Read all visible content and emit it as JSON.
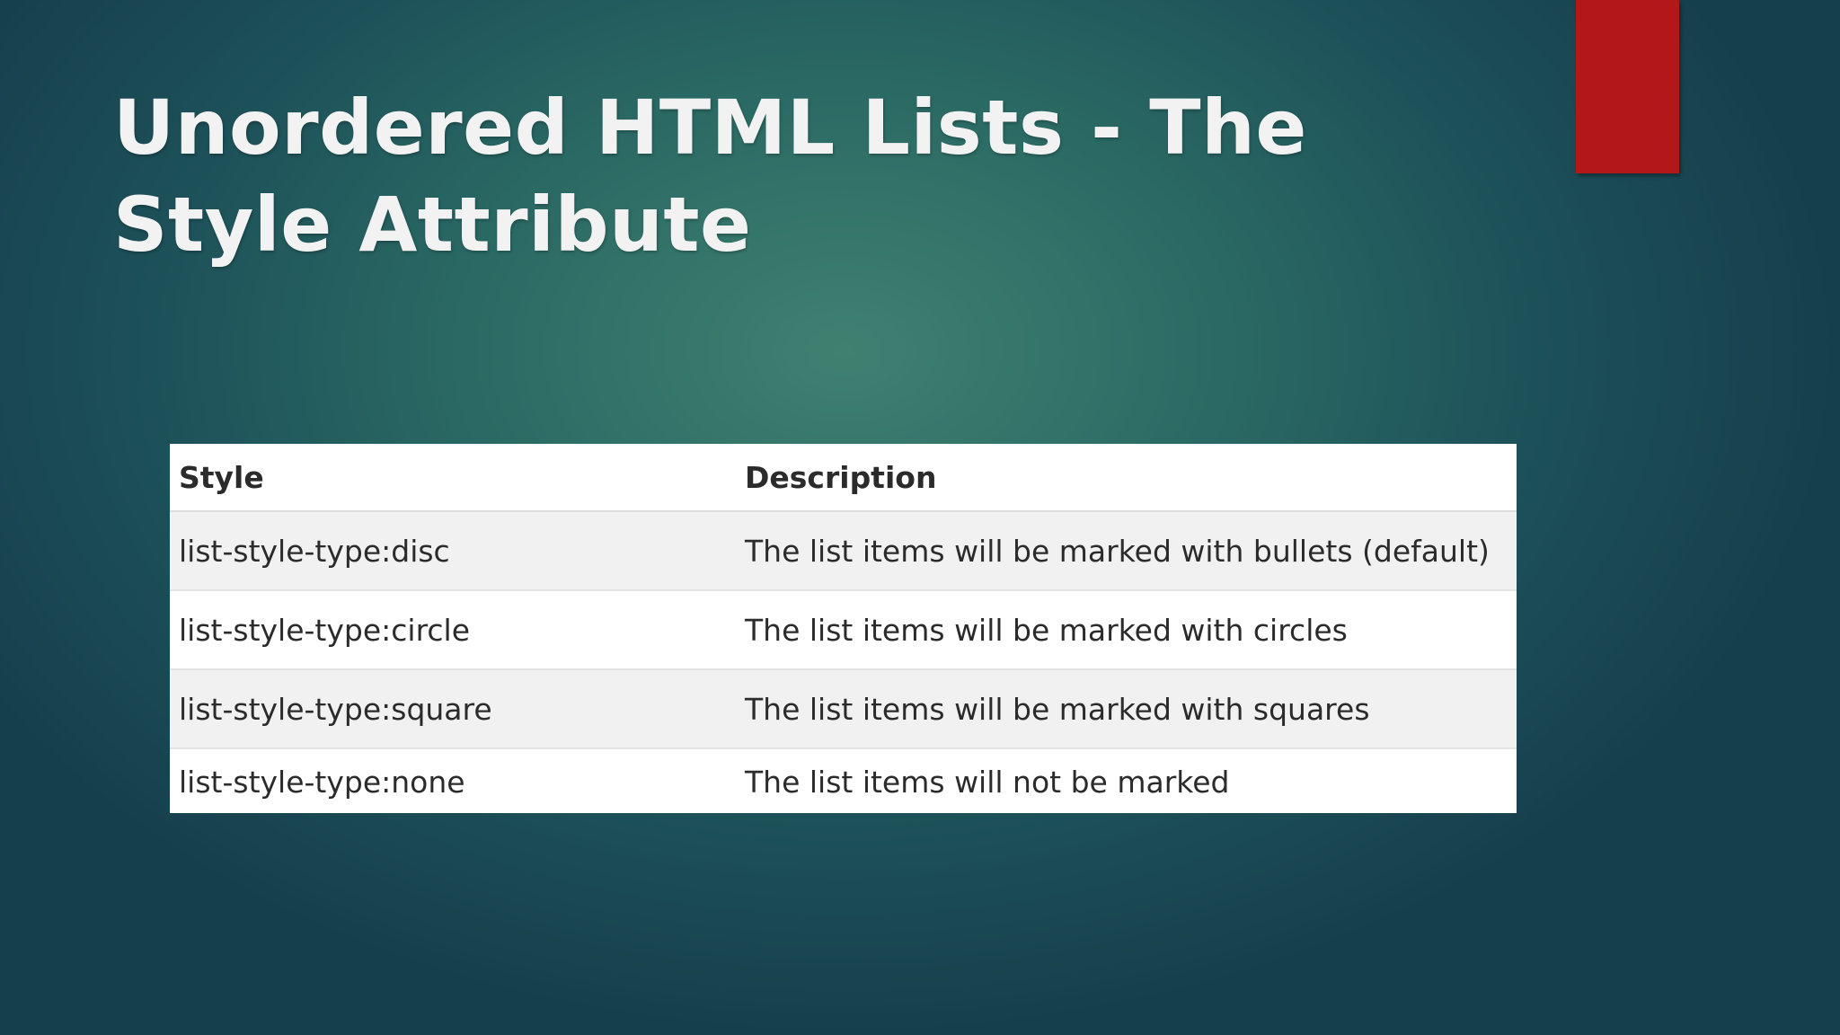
{
  "slide": {
    "title": "Unordered HTML Lists - The Style Attribute",
    "accent_color": "#b3171a"
  },
  "table": {
    "headers": [
      "Style",
      "Description"
    ],
    "rows": [
      {
        "style": "list-style-type:disc",
        "description": "The list items will be marked with bullets (default)"
      },
      {
        "style": "list-style-type:circle",
        "description": "The list items will be marked with circles"
      },
      {
        "style": "list-style-type:square",
        "description": "The list items will be marked with squares"
      },
      {
        "style": "list-style-type:none",
        "description": "The list items will not be marked"
      }
    ]
  }
}
